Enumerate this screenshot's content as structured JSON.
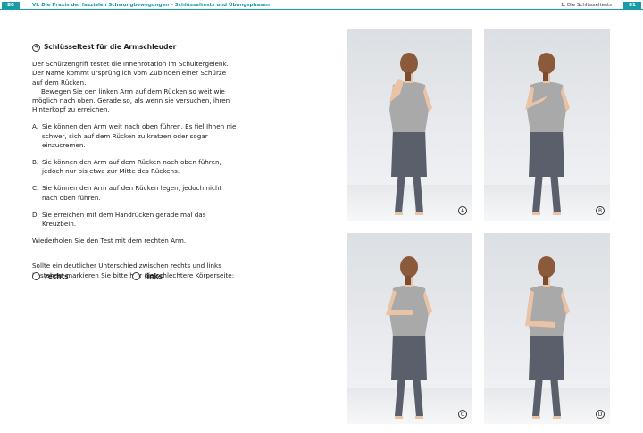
{
  "header": {
    "left_page_number": "80",
    "left_title": "VI. Die Praxis der faszialen Schwungbewegungen – Schlüsseltests und Übungsphasen",
    "right_title": "1. Die Schlüsseltests",
    "right_page_number": "81"
  },
  "section": {
    "number": "4",
    "title": "Schlüsseltest für die Armschleuder"
  },
  "intro": "Der Schürzengriff testet die Innenrotation im Schultergelenk. Der Name kommt ursprünglich vom Zubinden einer Schürze auf dem Rücken.",
  "instruction": "Bewegen Sie den linken Arm auf dem Rücken so weit wie möglich nach oben. Gerade so, als wenn sie versuchen, ihren Hinterkopf zu erreichen.",
  "options": [
    {
      "key": "A.",
      "text": "Sie können den Arm weit nach oben führen. Es fiel Ihnen nie schwer, sich auf dem Rücken zu kratzen oder sogar einzucremen."
    },
    {
      "key": "B.",
      "text": "Sie können den Arm auf dem Rücken nach oben führen, jedoch nur bis etwa zur Mitte des Rückens."
    },
    {
      "key": "C.",
      "text": "Sie können den Arm auf den Rücken legen, jedoch nicht nach oben führen."
    },
    {
      "key": "D.",
      "text": "Sie erreichen mit dem Handrücken gerade mal das Kreuzbein."
    }
  ],
  "repeat": "Wiederholen Sie den Test mit dem rechten Arm.",
  "question": "Sollte ein deutlicher Unterschied zwischen rechts und links bestehen, markieren Sie bitte hier die schlechtere Körperseite:",
  "choices": {
    "right": "rechts",
    "left": "links"
  },
  "photos": [
    {
      "label": "A"
    },
    {
      "label": "B"
    },
    {
      "label": "C"
    },
    {
      "label": "D"
    }
  ],
  "colors": {
    "accent": "#1a9ba8",
    "shirt": "#a9a9a9",
    "pants": "#5a5f6b",
    "skin": "#e8c3a6",
    "hair": "#8a5a3b"
  }
}
